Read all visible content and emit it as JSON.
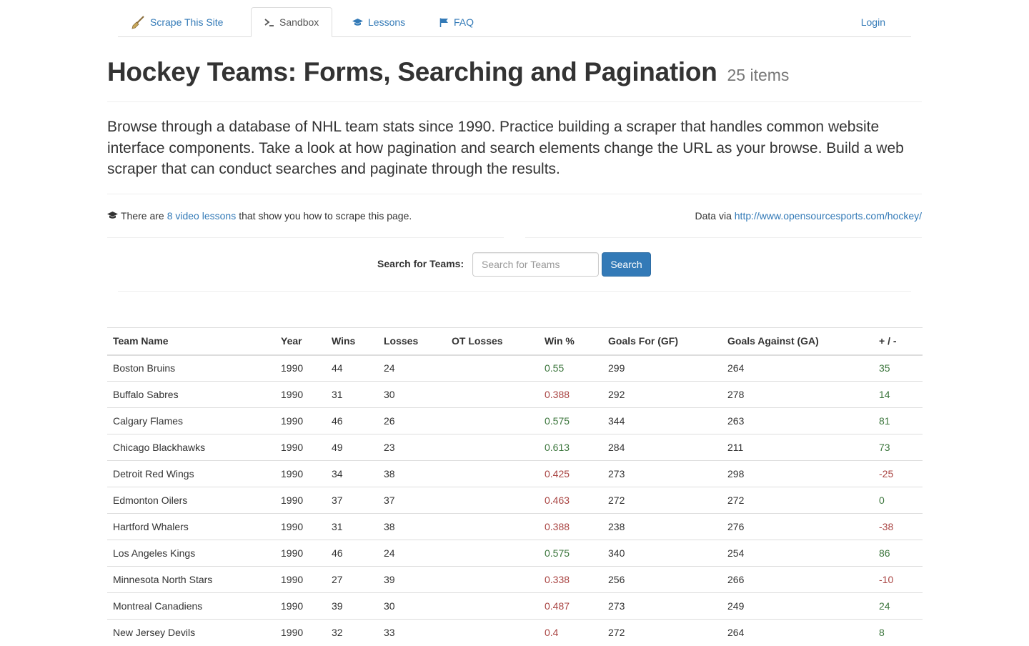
{
  "nav": {
    "brand": "Scrape This Site",
    "sandbox": "Sandbox",
    "lessons": "Lessons",
    "faq": "FAQ",
    "login": "Login"
  },
  "page": {
    "title": "Hockey Teams: Forms, Searching and Pagination",
    "count": "25 items",
    "lead": "Browse through a database of NHL team stats since 1990. Practice building a scraper that handles common website interface components. Take a look at how pagination and search elements change the URL as your browse. Build a web scraper that can conduct searches and paginate through the results."
  },
  "info": {
    "prefix": "There are",
    "link": "8 video lessons",
    "suffix": "that show you how to scrape this page.",
    "data_via": "Data via",
    "data_link": "http://www.opensourcesports.com/hockey/"
  },
  "search": {
    "label": "Search for Teams:",
    "placeholder": "Search for Teams",
    "button": "Search"
  },
  "colors": {
    "good": "#3c763d",
    "bad": "#a94442",
    "link": "#337ab7"
  },
  "table": {
    "headers": [
      "Team Name",
      "Year",
      "Wins",
      "Losses",
      "OT Losses",
      "Win %",
      "Goals For (GF)",
      "Goals Against (GA)",
      "+ / -"
    ],
    "rows": [
      {
        "team": "Boston Bruins",
        "year": "1990",
        "wins": "44",
        "losses": "24",
        "ot": "",
        "pct": "0.55",
        "pct_status": "good",
        "gf": "299",
        "ga": "264",
        "diff": "35",
        "diff_status": "good"
      },
      {
        "team": "Buffalo Sabres",
        "year": "1990",
        "wins": "31",
        "losses": "30",
        "ot": "",
        "pct": "0.388",
        "pct_status": "bad",
        "gf": "292",
        "ga": "278",
        "diff": "14",
        "diff_status": "good"
      },
      {
        "team": "Calgary Flames",
        "year": "1990",
        "wins": "46",
        "losses": "26",
        "ot": "",
        "pct": "0.575",
        "pct_status": "good",
        "gf": "344",
        "ga": "263",
        "diff": "81",
        "diff_status": "good"
      },
      {
        "team": "Chicago Blackhawks",
        "year": "1990",
        "wins": "49",
        "losses": "23",
        "ot": "",
        "pct": "0.613",
        "pct_status": "good",
        "gf": "284",
        "ga": "211",
        "diff": "73",
        "diff_status": "good"
      },
      {
        "team": "Detroit Red Wings",
        "year": "1990",
        "wins": "34",
        "losses": "38",
        "ot": "",
        "pct": "0.425",
        "pct_status": "bad",
        "gf": "273",
        "ga": "298",
        "diff": "-25",
        "diff_status": "bad"
      },
      {
        "team": "Edmonton Oilers",
        "year": "1990",
        "wins": "37",
        "losses": "37",
        "ot": "",
        "pct": "0.463",
        "pct_status": "bad",
        "gf": "272",
        "ga": "272",
        "diff": "0",
        "diff_status": "good"
      },
      {
        "team": "Hartford Whalers",
        "year": "1990",
        "wins": "31",
        "losses": "38",
        "ot": "",
        "pct": "0.388",
        "pct_status": "bad",
        "gf": "238",
        "ga": "276",
        "diff": "-38",
        "diff_status": "bad"
      },
      {
        "team": "Los Angeles Kings",
        "year": "1990",
        "wins": "46",
        "losses": "24",
        "ot": "",
        "pct": "0.575",
        "pct_status": "good",
        "gf": "340",
        "ga": "254",
        "diff": "86",
        "diff_status": "good"
      },
      {
        "team": "Minnesota North Stars",
        "year": "1990",
        "wins": "27",
        "losses": "39",
        "ot": "",
        "pct": "0.338",
        "pct_status": "bad",
        "gf": "256",
        "ga": "266",
        "diff": "-10",
        "diff_status": "bad"
      },
      {
        "team": "Montreal Canadiens",
        "year": "1990",
        "wins": "39",
        "losses": "30",
        "ot": "",
        "pct": "0.487",
        "pct_status": "bad",
        "gf": "273",
        "ga": "249",
        "diff": "24",
        "diff_status": "good"
      },
      {
        "team": "New Jersey Devils",
        "year": "1990",
        "wins": "32",
        "losses": "33",
        "ot": "",
        "pct": "0.4",
        "pct_status": "bad",
        "gf": "272",
        "ga": "264",
        "diff": "8",
        "diff_status": "good"
      }
    ]
  }
}
